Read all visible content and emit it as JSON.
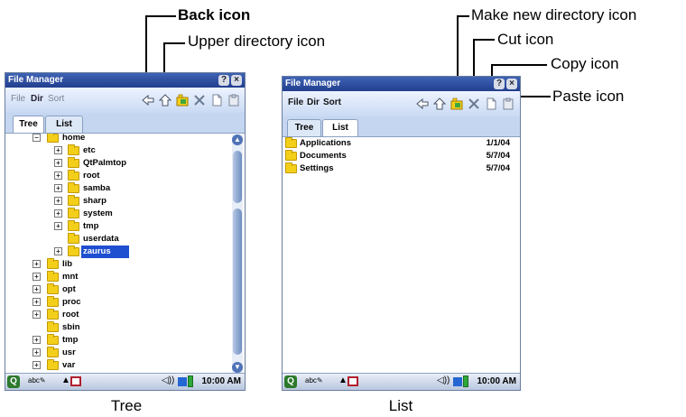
{
  "callouts": {
    "back_icon": "Back icon",
    "upper_dir_icon": "Upper directory icon",
    "make_dir_icon": "Make new directory icon",
    "cut_icon": "Cut icon",
    "copy_icon": "Copy icon",
    "paste_icon": "Paste icon"
  },
  "captions": {
    "tree": "Tree",
    "list": "List"
  },
  "window": {
    "title": "File Manager",
    "help_button": "?",
    "close_button": "×",
    "menus": {
      "file": "File",
      "dir": "Dir",
      "sort": "Sort"
    },
    "tabs": {
      "tree": "Tree",
      "list": "List"
    },
    "time": "10:00 AM"
  },
  "toolbar_icons": [
    "back-icon",
    "upper-directory-icon",
    "make-new-directory-icon",
    "cut-icon",
    "copy-icon",
    "paste-icon"
  ],
  "tree_view": {
    "items": [
      {
        "label": "home"
      },
      {
        "label": "etc"
      },
      {
        "label": "QtPalmtop"
      },
      {
        "label": "root"
      },
      {
        "label": "samba"
      },
      {
        "label": "sharp"
      },
      {
        "label": "system"
      },
      {
        "label": "tmp"
      },
      {
        "label": "userdata"
      },
      {
        "label": "zaurus"
      },
      {
        "label": "lib"
      },
      {
        "label": "mnt"
      },
      {
        "label": "opt"
      },
      {
        "label": "proc"
      },
      {
        "label": "root"
      },
      {
        "label": "sbin"
      },
      {
        "label": "tmp"
      },
      {
        "label": "usr"
      },
      {
        "label": "var"
      }
    ]
  },
  "list_view": {
    "rows": [
      {
        "name": "Applications",
        "date": "1/1/04"
      },
      {
        "name": "Documents",
        "date": "5/7/04"
      },
      {
        "name": "Settings",
        "date": "5/7/04"
      }
    ]
  },
  "colors": {
    "titlebar": "#2f4f9f",
    "folder": "#f4cf1a",
    "selection": "#1f4fd1",
    "toolbar": "#dbe6f8"
  }
}
